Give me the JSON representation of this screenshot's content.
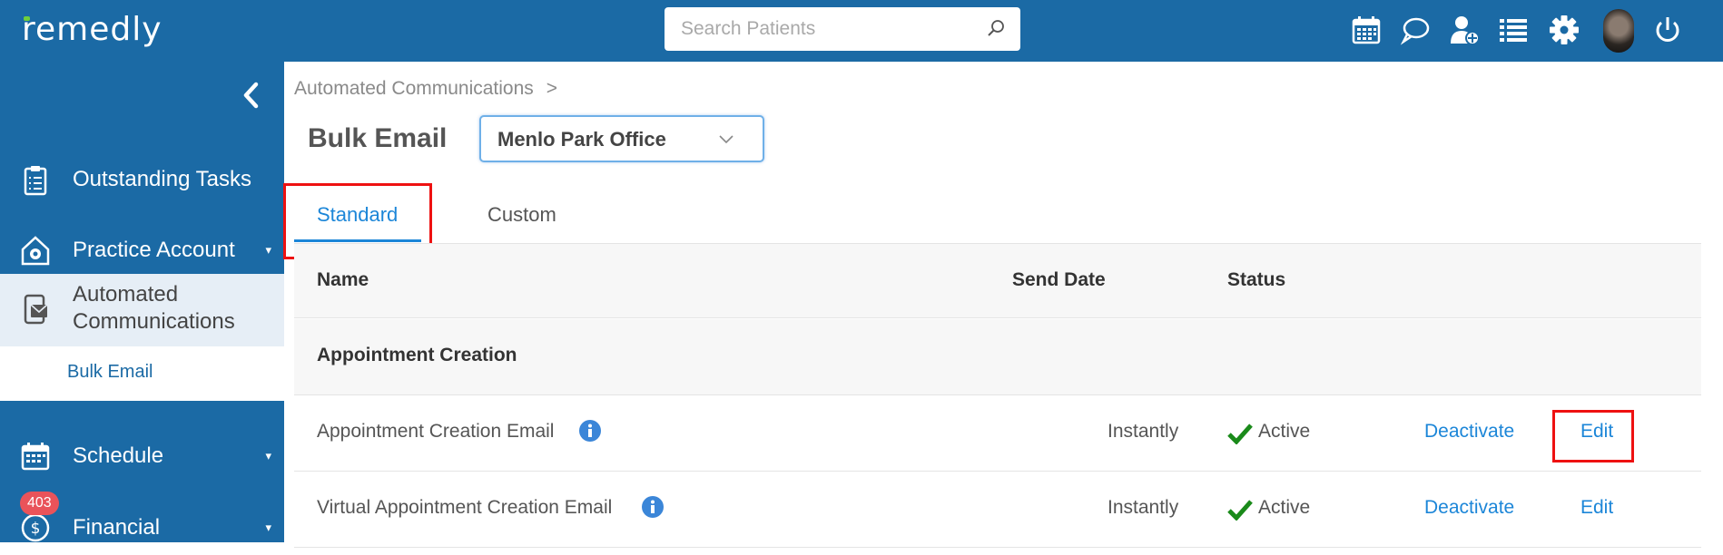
{
  "app": {
    "logo": "remedly",
    "search_placeholder": "Search Patients"
  },
  "header_icons": [
    "calendar-icon",
    "chat-icon",
    "add-user-icon",
    "list-icon",
    "gear-icon",
    "avatar",
    "power-icon"
  ],
  "colors": {
    "brand": "#1b6aa5",
    "link": "#1c86d8",
    "check": "#1a8a1a",
    "badge": "#e9535a",
    "highlight_box": "#e11111"
  },
  "sidebar": {
    "items": [
      {
        "label": "Outstanding Tasks",
        "icon": "clipboard-icon"
      },
      {
        "label": "Practice Account",
        "icon": "gear-house-icon",
        "caret": "▾"
      },
      {
        "label": "Automated Communications",
        "icon": "devices-icon",
        "active": true
      },
      {
        "label": "Bulk Email",
        "sub": true
      },
      {
        "label": "Schedule",
        "icon": "calendar-icon",
        "caret": "▾"
      },
      {
        "label": "Financial",
        "icon": "dollar-icon",
        "caret": "▾",
        "badge": "403"
      }
    ]
  },
  "main": {
    "breadcrumb": "Automated Communications",
    "breadcrumb_sep": ">",
    "title": "Bulk Email",
    "office_selected": "Menlo Park Office",
    "tabs": [
      {
        "label": "Standard",
        "active": true
      },
      {
        "label": "Custom",
        "active": false
      }
    ],
    "table": {
      "columns": [
        "Name",
        "Send Date",
        "Status"
      ],
      "group": "Appointment Creation",
      "rows": [
        {
          "name": "Appointment Creation Email",
          "send_date": "Instantly",
          "status": "Active",
          "deactivate": "Deactivate",
          "edit": "Edit"
        },
        {
          "name": "Virtual Appointment Creation Email",
          "send_date": "Instantly",
          "status": "Active",
          "deactivate": "Deactivate",
          "edit": "Edit"
        }
      ]
    }
  }
}
